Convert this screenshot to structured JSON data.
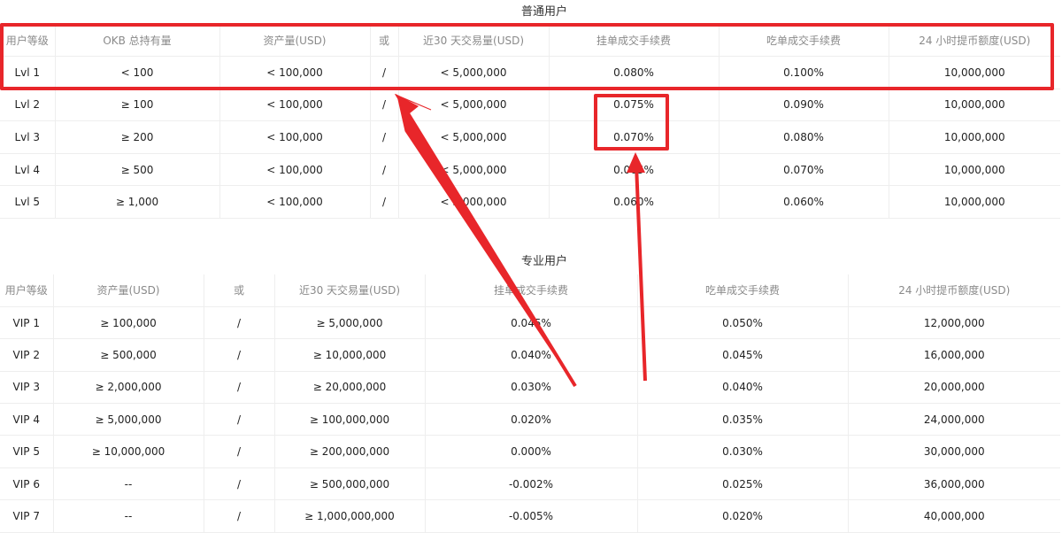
{
  "regular": {
    "title": "普通用户",
    "headers": [
      "用户等级",
      "OKB 总持有量",
      "资产量(USD)",
      "或",
      "近30 天交易量(USD)",
      "挂单成交手续费",
      "吃单成交手续费",
      "24 小时提币额度(USD)"
    ],
    "rows": [
      [
        "Lvl 1",
        "< 100",
        "< 100,000",
        "/",
        "< 5,000,000",
        "0.080%",
        "0.100%",
        "10,000,000"
      ],
      [
        "Lvl 2",
        "≥ 100",
        "< 100,000",
        "/",
        "< 5,000,000",
        "0.075%",
        "0.090%",
        "10,000,000"
      ],
      [
        "Lvl 3",
        "≥ 200",
        "< 100,000",
        "/",
        "< 5,000,000",
        "0.070%",
        "0.080%",
        "10,000,000"
      ],
      [
        "Lvl 4",
        "≥ 500",
        "< 100,000",
        "/",
        "< 5,000,000",
        "0.065%",
        "0.070%",
        "10,000,000"
      ],
      [
        "Lvl 5",
        "≥ 1,000",
        "< 100,000",
        "/",
        "< 5,000,000",
        "0.060%",
        "0.060%",
        "10,000,000"
      ]
    ]
  },
  "pro": {
    "title": "专业用户",
    "headers": [
      "用户等级",
      "资产量(USD)",
      "或",
      "近30 天交易量(USD)",
      "挂单成交手续费",
      "吃单成交手续费",
      "24 小时提币额度(USD)"
    ],
    "rows": [
      [
        "VIP 1",
        "≥ 100,000",
        "/",
        "≥ 5,000,000",
        "0.045%",
        "0.050%",
        "12,000,000"
      ],
      [
        "VIP 2",
        "≥ 500,000",
        "/",
        "≥ 10,000,000",
        "0.040%",
        "0.045%",
        "16,000,000"
      ],
      [
        "VIP 3",
        "≥ 2,000,000",
        "/",
        "≥ 20,000,000",
        "0.030%",
        "0.040%",
        "20,000,000"
      ],
      [
        "VIP 4",
        "≥ 5,000,000",
        "/",
        "≥ 100,000,000",
        "0.020%",
        "0.035%",
        "24,000,000"
      ],
      [
        "VIP 5",
        "≥ 10,000,000",
        "/",
        "≥ 200,000,000",
        "0.000%",
        "0.030%",
        "30,000,000"
      ],
      [
        "VIP 6",
        "--",
        "/",
        "≥ 500,000,000",
        "-0.002%",
        "0.025%",
        "36,000,000"
      ],
      [
        "VIP 7",
        "--",
        "/",
        "≥ 1,000,000,000",
        "-0.005%",
        "0.020%",
        "40,000,000"
      ]
    ]
  },
  "annotation_color": "#e8262a"
}
